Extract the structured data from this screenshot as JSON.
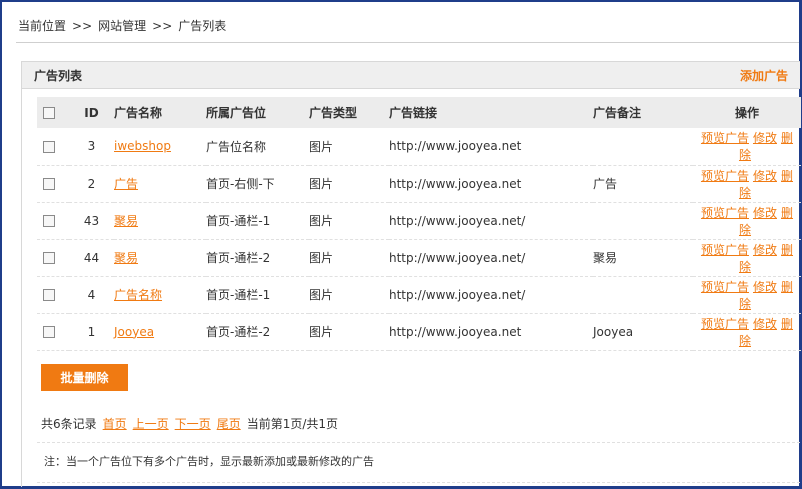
{
  "breadcrumb": {
    "items": [
      "当前位置",
      "网站管理",
      "广告列表"
    ],
    "separator": ">>"
  },
  "panel": {
    "title": "广告列表",
    "add_label": "添加广告"
  },
  "table": {
    "headers": {
      "id": "ID",
      "name": "广告名称",
      "position": "所属广告位",
      "type": "广告类型",
      "url": "广告链接",
      "note": "广告备注",
      "ops": "操作"
    },
    "rows": [
      {
        "id": "3",
        "name": "iwebshop",
        "position": "广告位名称",
        "type": "图片",
        "url": "http://www.jooyea.net",
        "note": ""
      },
      {
        "id": "2",
        "name": "广告",
        "position": "首页-右侧-下",
        "type": "图片",
        "url": "http://www.jooyea.net",
        "note": "广告"
      },
      {
        "id": "43",
        "name": "聚易",
        "position": "首页-通栏-1",
        "type": "图片",
        "url": "http://www.jooyea.net/",
        "note": ""
      },
      {
        "id": "44",
        "name": "聚易",
        "position": "首页-通栏-2",
        "type": "图片",
        "url": "http://www.jooyea.net/",
        "note": "聚易"
      },
      {
        "id": "4",
        "name": "广告名称",
        "position": "首页-通栏-1",
        "type": "图片",
        "url": "http://www.jooyea.net/",
        "note": ""
      },
      {
        "id": "1",
        "name": "Jooyea",
        "position": "首页-通栏-2",
        "type": "图片",
        "url": "http://www.jooyea.net",
        "note": "Jooyea"
      }
    ],
    "ops": {
      "preview": "预览广告",
      "edit": "修改",
      "delete": "删除"
    }
  },
  "batch_delete_label": "批量删除",
  "pager": {
    "total": "共6条记录",
    "first": "首页",
    "prev": "上一页",
    "next": "下一页",
    "last": "尾页",
    "current": "当前第1页/共1页"
  },
  "note": "注：当一个广告位下有多个广告时，显示最新添加或最新修改的广告",
  "colors": {
    "accent": "#f07a12",
    "frame": "#1f3d8a",
    "header_bg": "#ececec"
  }
}
